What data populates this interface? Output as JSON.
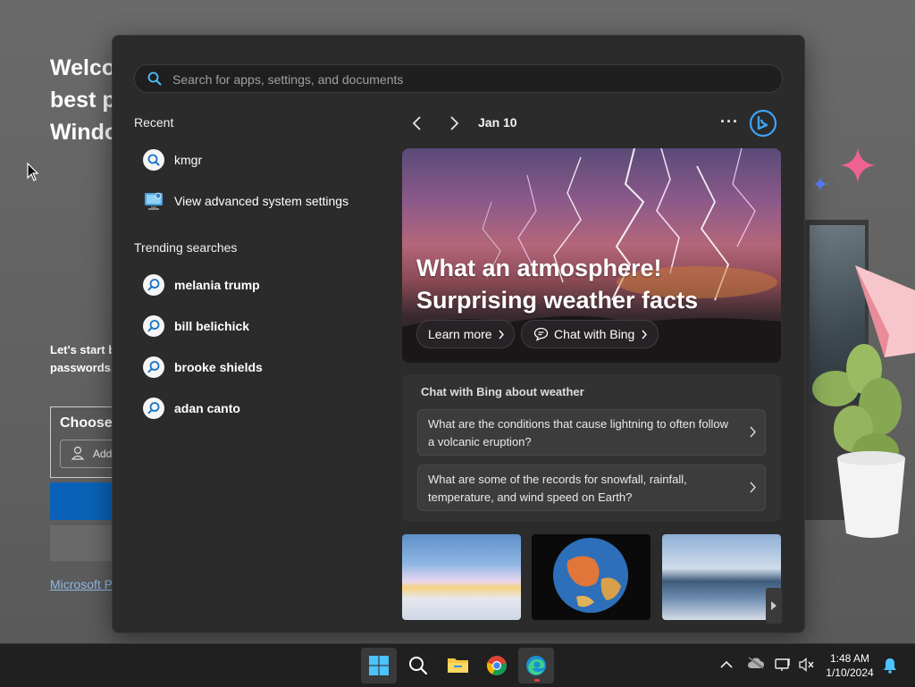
{
  "background_app": {
    "title_lines": [
      "Welco",
      "best p",
      "Windo"
    ],
    "body_lines": [
      "Let's start b",
      "passwords,"
    ],
    "card_title": "Choose",
    "card_input_label": "Add",
    "link_text": "Microsoft P"
  },
  "search": {
    "placeholder": "Search for apps, settings, and documents",
    "value": ""
  },
  "recent": {
    "title": "Recent",
    "items": [
      {
        "label": "kmgr",
        "icon": "search-icon"
      },
      {
        "label": "View advanced system settings",
        "icon": "system-settings-icon"
      }
    ]
  },
  "trending": {
    "title": "Trending searches",
    "items": [
      {
        "label": "melania trump"
      },
      {
        "label": "bill belichick"
      },
      {
        "label": "brooke shields"
      },
      {
        "label": "adan canto"
      }
    ]
  },
  "highlights": {
    "date": "Jan 10",
    "more_label": "···",
    "hero": {
      "title_line1": "What an atmosphere!",
      "title_line2": "Surprising weather facts",
      "learn_more": "Learn more",
      "chat_with_bing": "Chat with Bing"
    },
    "chat_card": {
      "title": "Chat with Bing about weather",
      "questions": [
        "What are the conditions that cause lightning to often follow a volcanic eruption?",
        "What are some of the records for snowfall, rainfall, temperature, and wind speed on Earth?"
      ]
    },
    "thumbnails": [
      "rainbow-clouds",
      "earth-globe",
      "snowy-river"
    ]
  },
  "taskbar": {
    "apps": [
      "start",
      "search",
      "file-explorer",
      "chrome",
      "edge"
    ],
    "clock_time": "1:48 AM",
    "clock_date": "1/10/2024"
  },
  "colors": {
    "panel_bg": "#2b2b2b",
    "accent_blue": "#0a62b8",
    "taskbar_bg": "#202020",
    "edge_indicator": "#e0443a"
  }
}
